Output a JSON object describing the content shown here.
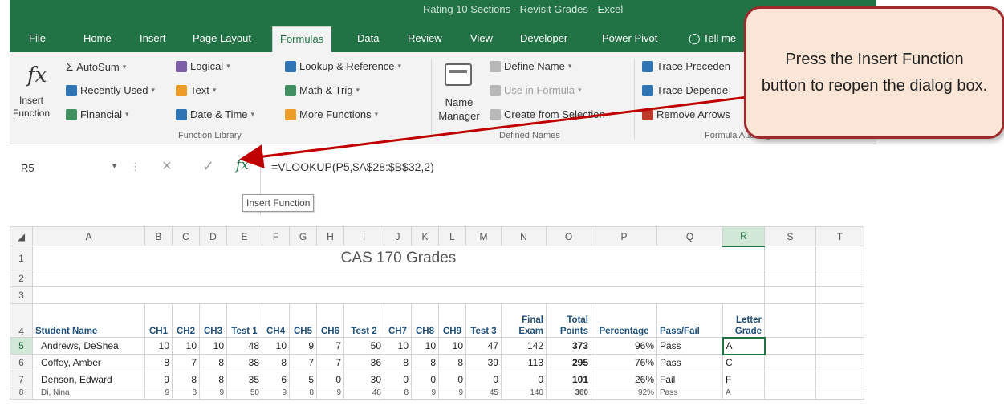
{
  "window": {
    "title": "Rating 10 Sections - Revisit Grades - Excel"
  },
  "tabs": [
    {
      "label": "File"
    },
    {
      "label": "Home"
    },
    {
      "label": "Insert"
    },
    {
      "label": "Page Layout"
    },
    {
      "label": "Formulas",
      "active": true
    },
    {
      "label": "Data"
    },
    {
      "label": "Review"
    },
    {
      "label": "View"
    },
    {
      "label": "Developer"
    },
    {
      "label": "Power Pivot"
    },
    {
      "label": "Tell me"
    }
  ],
  "ribbon": {
    "function_library": {
      "insert_function": "Insert Function",
      "insert_function_line1": "Insert",
      "insert_function_line2": "Function",
      "autosum": "AutoSum",
      "recently_used": "Recently Used",
      "financial": "Financial",
      "logical": "Logical",
      "text": "Text",
      "date_time": "Date & Time",
      "lookup_reference": "Lookup & Reference",
      "math_trig": "Math & Trig",
      "more_functions": "More Functions",
      "group_label": "Function Library"
    },
    "defined_names": {
      "name_manager_line1": "Name",
      "name_manager_line2": "Manager",
      "define_name": "Define Name",
      "use_in_formula": "Use in Formula",
      "create_from_selection": "Create from Selection",
      "group_label": "Defined Names"
    },
    "formula_auditing": {
      "trace_precedents": "Trace Preceden",
      "trace_dependents": "Trace Depende",
      "remove_arrows": "Remove Arrows",
      "group_label": "Formula Auditing"
    }
  },
  "formula_bar": {
    "name_box": "R5",
    "formula": "=VLOOKUP(P5,$A$28:$B$32,2)",
    "tooltip": "Insert Function"
  },
  "callout": {
    "text": "Press the Insert Function button to reopen the dialog box."
  },
  "colors": {
    "excel_green": "#217346",
    "callout_fill": "#fbe5d6",
    "callout_border": "#9e2a2b",
    "arrow": "#c00000"
  },
  "sheet": {
    "columns": [
      "A",
      "B",
      "C",
      "D",
      "E",
      "F",
      "G",
      "H",
      "I",
      "J",
      "K",
      "L",
      "M",
      "N",
      "O",
      "P",
      "Q",
      "R",
      "S",
      "T"
    ],
    "title": "CAS 170 Grades",
    "header_row": [
      "Student Name",
      "CH1",
      "CH2",
      "CH3",
      "Test 1",
      "CH4",
      "CH5",
      "CH6",
      "Test 2",
      "CH7",
      "CH8",
      "CH9",
      "Test 3",
      "Final Exam",
      "Total Points",
      "Percentage",
      "Pass/Fail",
      "Letter Grade"
    ],
    "rows": [
      {
        "num": "5",
        "cells": [
          "Andrews, DeShea",
          "10",
          "10",
          "10",
          "48",
          "10",
          "9",
          "7",
          "50",
          "10",
          "10",
          "10",
          "47",
          "142",
          "373",
          "96%",
          "Pass",
          "A"
        ]
      },
      {
        "num": "6",
        "cells": [
          "Coffey, Amber",
          "8",
          "7",
          "8",
          "38",
          "8",
          "7",
          "7",
          "36",
          "8",
          "8",
          "8",
          "39",
          "113",
          "295",
          "76%",
          "Pass",
          "C"
        ]
      },
      {
        "num": "7",
        "cells": [
          "Denson, Edward",
          "9",
          "8",
          "8",
          "35",
          "6",
          "5",
          "0",
          "30",
          "0",
          "0",
          "0",
          "0",
          "0",
          "101",
          "26%",
          "Fail",
          "F"
        ]
      },
      {
        "num": "8",
        "cells": [
          "Di, Nina",
          "9",
          "8",
          "9",
          "50",
          "9",
          "8",
          "9",
          "48",
          "8",
          "9",
          "9",
          "45",
          "140",
          "360",
          "92%",
          "Pass",
          "A"
        ]
      }
    ]
  }
}
